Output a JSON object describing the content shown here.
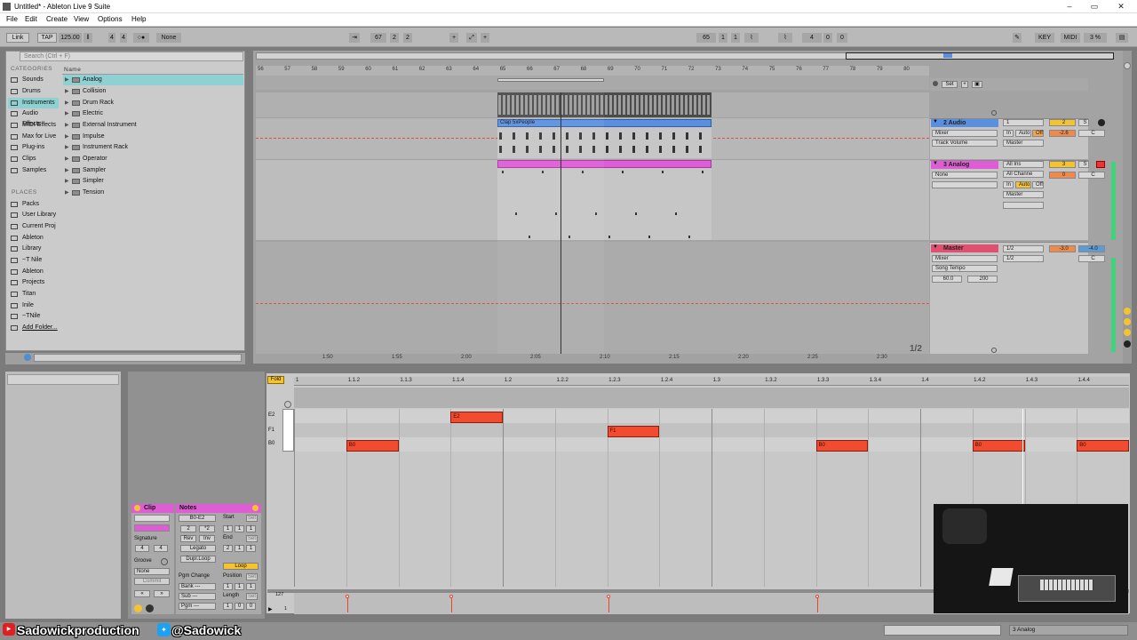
{
  "window": {
    "title": "Untitled* - Ableton Live 9 Suite",
    "min": "–",
    "restore": "▭",
    "close": "✕"
  },
  "menu": [
    "File",
    "Edit",
    "Create",
    "View",
    "Options",
    "Help"
  ],
  "control": {
    "link": "Link",
    "tap": "TAP",
    "tempo": "125.00",
    "sig_num": "4",
    "sig_den": "4",
    "metro": "○●",
    "quant": "None",
    "pos_bar": "67",
    "pos_beat": "2",
    "pos_sixteenth": "2",
    "loop_start_bar": "65",
    "loop_start_beat": "1",
    "loop_start_six": "1",
    "loop_len_bar": "4",
    "loop_len_beat": "0",
    "loop_len_six": "0",
    "key": "KEY",
    "midi": "MIDI",
    "cpu": "3 %"
  },
  "browser": {
    "search_placeholder": "Search (Ctrl + F)",
    "categories_header": "CATEGORIES",
    "categories": [
      "Sounds",
      "Drums",
      "Instruments",
      "Audio Effects",
      "MIDI Effects",
      "Max for Live",
      "Plug-ins",
      "Clips",
      "Samples"
    ],
    "selected_category": "Instruments",
    "places_header": "PLACES",
    "places": [
      "Packs",
      "User Library",
      "Current Proj",
      "Ableton",
      "Library",
      "~T Nile",
      "Ableton",
      "Projects",
      "Titan",
      "Inile",
      "~TNile",
      "Add Folder..."
    ],
    "name_header": "Name",
    "items": [
      "Analog",
      "Collision",
      "Drum Rack",
      "Electric",
      "External Instrument",
      "Impulse",
      "Instrument Rack",
      "Operator",
      "Sampler",
      "Simpler",
      "Tension"
    ],
    "selected_item": "Analog"
  },
  "arrangement": {
    "ruler_bars": [
      "56",
      "57",
      "58",
      "59",
      "60",
      "61",
      "62",
      "63",
      "64",
      "65",
      "66",
      "67",
      "68",
      "69",
      "70",
      "71",
      "72",
      "73",
      "74",
      "75",
      "76",
      "77",
      "78",
      "79",
      "80"
    ],
    "time_labels": [
      "1:50",
      "1:55",
      "2:00",
      "2:05",
      "2:10",
      "2:15",
      "2:20",
      "2:25",
      "2:30"
    ],
    "page_indicator": "1/2",
    "set_label": "Set",
    "audio_clip_name": "Clap 5xPeople",
    "tracks": [
      {
        "name": "2 Audio",
        "color": "#5a8fe0",
        "input": "Mixer",
        "param": "Track Volume",
        "io1": "1",
        "io2": "In",
        "io3": "Auto",
        "io4": "Off",
        "out": "Master",
        "num": "2",
        "vol": "-2.6",
        "pan": "C",
        "solo": "S"
      },
      {
        "name": "3 Analog",
        "color": "#e05cd6",
        "input": "None",
        "io1": "All Ins",
        "io2": "All Channe",
        "io3": "In",
        "io4": "Auto",
        "io5": "Off",
        "out": "Master",
        "num": "3",
        "vol": "0",
        "pan": "C",
        "solo": "S"
      },
      {
        "name": "Master",
        "color": "#e05070",
        "input": "Mixer",
        "param": "Song Tempo",
        "min": "60.0",
        "max": "200",
        "io1": "1/2",
        "io2": "1/2",
        "vol": "-3.0",
        "vol2": "-4.0",
        "pan": "C"
      }
    ]
  },
  "detail": {
    "clip_header": "Clip",
    "notes_header": "Notes",
    "signature": "Signature",
    "sig_num": "4",
    "sig_den": "4",
    "groove": "Groove",
    "groove_val": "None",
    "commit": "Commit",
    "range": "B0-E2",
    "half": "2",
    "double": "*2",
    "rev": "Rev",
    "inv": "Inv",
    "legato": "Legato",
    "dupl": "Dupl.Loop",
    "start": "Start",
    "set": "Set",
    "end": "End",
    "loop": "Loop",
    "pgm_change": "Pgm Change",
    "bank": "Bank ---",
    "sub": "Sub ---",
    "pgm": "Pgm ---",
    "position": "Position",
    "length": "Length",
    "start_v": [
      "1",
      "1",
      "1"
    ],
    "end_v": [
      "2",
      "1",
      "1"
    ],
    "pos_v": [
      "1",
      "1",
      "1"
    ],
    "len_v": [
      "1",
      "0",
      "0"
    ]
  },
  "pianoroll": {
    "fold": "Fold",
    "ruler": [
      "1",
      "1.1.2",
      "1.1.3",
      "1.1.4",
      "1.2",
      "1.2.2",
      "1.2.3",
      "1.2.4",
      "1.3",
      "1.3.2",
      "1.3.3",
      "1.3.4",
      "1.4",
      "1.4.2",
      "1.4.3",
      "1.4.4"
    ],
    "keys": [
      "E2",
      "F1",
      "B0"
    ],
    "vel_max": "127",
    "vel_min": "1",
    "notes": [
      {
        "pitch": "B0",
        "start": 0.0625,
        "len": 0.0625
      },
      {
        "pitch": "E2",
        "start": 0.1875,
        "len": 0.0625
      },
      {
        "pitch": "F1",
        "start": 0.375,
        "len": 0.0625
      },
      {
        "pitch": "B0",
        "start": 0.625,
        "len": 0.0625
      },
      {
        "pitch": "B0",
        "start": 0.8125,
        "len": 0.0625
      },
      {
        "pitch": "B0",
        "start": 0.9375,
        "len": 0.0625
      }
    ]
  },
  "footer": {
    "youtube": "Sadowickproduction",
    "twitter": "@Sadowick",
    "track_status": "3 Analog"
  }
}
